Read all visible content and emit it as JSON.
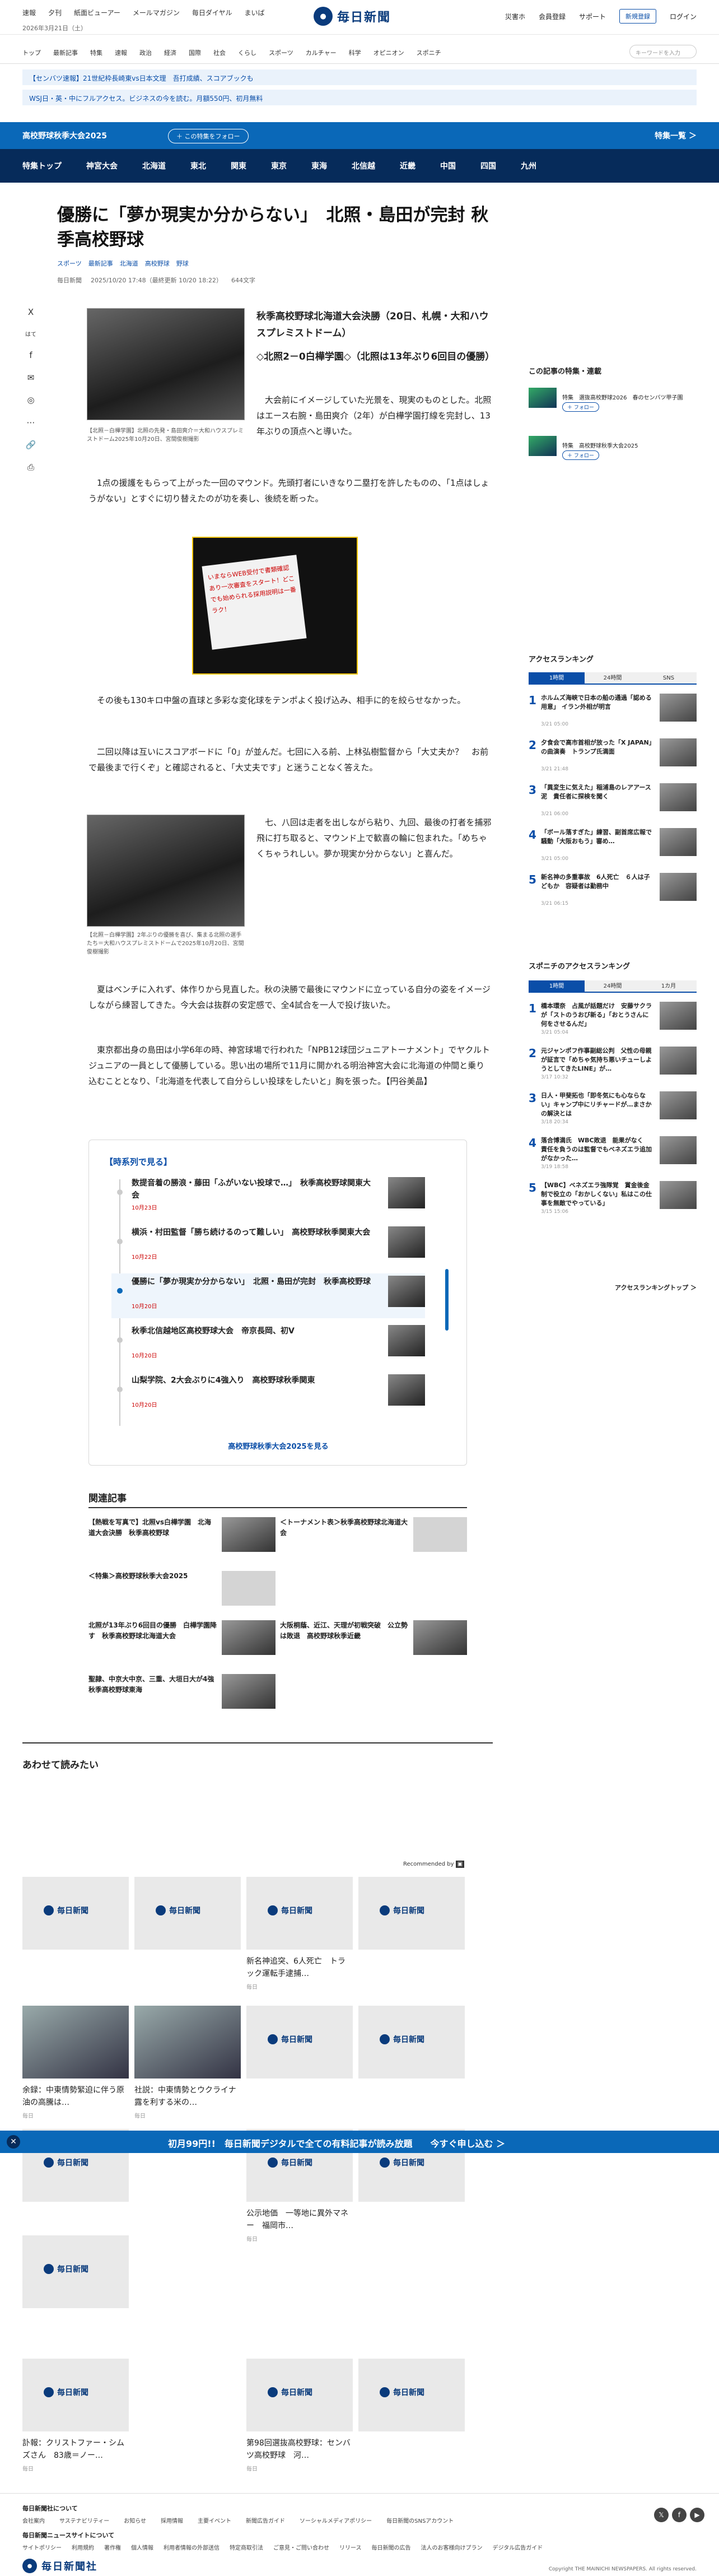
{
  "header": {
    "left_links": [
      "速報",
      "夕刊",
      "紙面ビューアー",
      "メールマガジン",
      "毎日ダイヤル",
      "まいば"
    ],
    "date": "2026年3月21日（土）",
    "logo_text": "毎日新聞",
    "right_links": [
      "災害ホ",
      "会員登録",
      "サポート"
    ],
    "register_label": "新規登録",
    "login_label": "ログイン"
  },
  "categories": [
    "トップ",
    "最新記事",
    "特集",
    "速報",
    "政治",
    "経済",
    "国際",
    "社会",
    "くらし",
    "スポーツ",
    "カルチャー",
    "科学",
    "オピニオン",
    "スポニチ"
  ],
  "search_placeholder": "キーワードを入力",
  "promos": [
    "【センバツ速報】21世紀枠長崎東vs日本文理　吾打成績、スコアブックも",
    "WSJ日・英・中にフルアクセス。ビジネスの今を読む。月額550円、初月無料"
  ],
  "series_bar": {
    "title": "高校野球秋季大会2025",
    "follow": "＋ この特集をフォロー",
    "special": "特集一覧 ＞"
  },
  "tabs": [
    "特集トップ",
    "神宮大会",
    "北海道",
    "東北",
    "関東",
    "東京",
    "東海",
    "北信越",
    "近畿",
    "中国",
    "四国",
    "九州"
  ],
  "article": {
    "title": "優勝に「夢か現実か分からない」　北照・島田が完封 秋季高校野球",
    "tags": [
      "スポーツ",
      "最新記事",
      "北海道",
      "高校野球",
      "野球"
    ],
    "meta": [
      "毎日新聞",
      "2025/10/20 17:48（最終更新 10/20 18:22）",
      "644文字"
    ],
    "share_icons": [
      "X",
      "はて",
      "f",
      "✉",
      "◎",
      "⋯",
      "🔗",
      "⎙"
    ],
    "caption1": "【北照－白樺学園】北照の先発・島田爽介＝大和ハウスプレミストドーム2025年10月20日、宮間俊樹撮影",
    "subhead1": "秋季高校野球北海道大会決勝（20日、札幌・大和ハウスプレミストドーム）",
    "subhead2": "◇北照2－0白樺学園◇（北照は13年ぶり6回目の優勝）",
    "para1": "大会前にイメージしていた光景を、現実のものとした。北照はエース右腕・島田爽介（2年）が白樺学園打線を完封し、13年ぶりの頂点へと導いた。",
    "para2": "1点の援護をもらって上がった一回のマウンド。先頭打者にいきなり二塁打を許したものの、「1点はしょうがない」とすぐに切り替えたのが功を奏し、後続を断った。",
    "ad_text": "いまならWEB受付で書類確認あり一次審査をスタート！どこでも始められる採用説明は一番ラク！",
    "para3": "その後も130キロ中盤の直球と多彩な変化球をテンポよく投げ込み、相手に的を絞らせなかった。",
    "para4": "二回以降は互いにスコアボードに「0」が並んだ。七回に入る前、上林弘樹監督から「大丈夫か？　お前で最後まで行くぞ」と確認されると、「大丈夫です」と迷うことなく答えた。",
    "caption2": "【北照－白樺学園】2年ぶりの優勝を喜び、集まる北照の選手たち＝大和ハウスプレミストドームで2025年10月20日、宮間俊樹撮影",
    "para5": "七、八回は走者を出しながら粘り、九回、最後の打者を捕邪飛に打ち取ると、マウンド上で歓喜の輪に包まれた。「めちゃくちゃうれしい。夢か現実か分からない」と喜んだ。",
    "para6": "夏はベンチに入れず、体作りから見直した。秋の決勝で最後にマウンドに立っている自分の姿をイメージしながら練習してきた。今大会は抜群の安定感で、全4試合を一人で投げ抜いた。",
    "para7": "東京都出身の島田は小学6年の時、神宮球場で行われた「NPB12球団ジュニアトーナメント」でヤクルトジュニアの一員として優勝している。思い出の場所で11月に開かれる明治神宮大会に北海道の仲間と乗り込むこととなり、「北海道を代表して自分らしい投球をしたいと」胸を張った。【円谷美晶】"
  },
  "series": {
    "head": "【時系列で見る】",
    "items": [
      {
        "title": "数提音着の勝浪・藤田「ふがいない投球で…」　秋季高校野球関東大会",
        "date": "10月23日"
      },
      {
        "title": "横浜・村田監督「勝ち続けるのって難しい」　高校野球秋季関東大会",
        "date": "10月22日"
      },
      {
        "title": "優勝に「夢か現実か分からない」　北照・島田が完封　秋季高校野球",
        "date": "10月20日"
      },
      {
        "title": "秋季北信越地区高校野球大会　帝京長岡、初V",
        "date": "10月20日"
      },
      {
        "title": "山梨学院、2大会ぶりに4強入り　高校野球秋季関東",
        "date": "10月20日"
      }
    ],
    "more": "高校野球秋季大会2025を見る"
  },
  "related": {
    "head": "関連記事",
    "items": [
      "【熱戦を写真で】北照vs白樺学園　北海道大会決勝　秋季高校野球",
      "＜トーナメント表＞秋季高校野球北海道大会",
      "＜特集＞高校野球秋季大会2025",
      "北照が13年ぶり6回目の優勝　白樺学園降す　秋季高校野球北海道大会",
      "大阪桐蔭、近江、天理が初戦突破　公立勢は敗退　高校野球秋季近畿",
      "聖隷、中京大中京、三重、大垣日大が4強　秋季高校野球東海"
    ]
  },
  "also_read": {
    "head": "あわせて読みたい",
    "rec": "Recommended by",
    "cards": [
      {
        "title": "",
        "source": ""
      },
      {
        "title": "",
        "source": ""
      },
      {
        "title": "新名神追突、6人死亡　トラック運転手逮捕…",
        "source": "毎日"
      },
      {
        "title": "",
        "source": ""
      },
      {
        "title": "余録：中東情勢緊迫に伴う原油の高騰は…",
        "source": "毎日"
      },
      {
        "title": "社説：中東情勢とウクライナ　露を利する米の…",
        "source": "毎日"
      },
      {
        "title": "",
        "source": ""
      },
      {
        "title": "",
        "source": ""
      },
      {
        "title": "",
        "source": ""
      },
      {
        "title": "公示地価　一等地に異外マネー　福岡市…",
        "source": "毎日"
      },
      {
        "title": "",
        "source": ""
      },
      {
        "title": "",
        "source": ""
      },
      {
        "title": "訃報：クリストファー・シムズさん　83歳＝ノー…",
        "source": "毎日"
      },
      {
        "title": "第98回選抜高校野球：センバツ高校野球　河…",
        "source": "毎日"
      },
      {
        "title": "",
        "source": ""
      }
    ]
  },
  "banner": {
    "text": "初月99円!!　毎日新聞デジタルで全ての有料記事が読み放題　　今すぐ申し込む ＞"
  },
  "sidebar": {
    "follow_head": "この記事の特集・連載",
    "follows": [
      {
        "label": "特集　選抜高校野球2026　春のセンバツ甲子園",
        "follow": "＋ フォロー"
      },
      {
        "label": "特集　高校野球秋季大会2025",
        "follow": "＋ フォロー"
      }
    ],
    "ranking_head": "アクセスランキング",
    "ranking_tabs": [
      "1時間",
      "24時間",
      "SNS"
    ],
    "ranking": [
      {
        "title": "ホルムズ海峡で日本の船の通過「認める用意」 イラン外相が明言",
        "date": "3/21 05:00"
      },
      {
        "title": "夕食会で高市首相が放った「X JAPAN」の曲演奏　トランプ氏満面",
        "date": "3/21 21:48"
      },
      {
        "title": "「異変生に気えた」稲浦島のレアアース泥　貴任者に探検を聞く",
        "date": "3/21 06:00"
      },
      {
        "title": "「ボール落すぎた」練習、副首席広報で騒動「大阪おもう」審め…",
        "date": "3/21 05:00"
      },
      {
        "title": "新名神の多重事故　6人死亡　６人は子どもか　容疑者は勤務中",
        "date": "3/21 06:15"
      }
    ],
    "sponichi_head": "スポニチのアクセスランキング",
    "sponichi_tabs": [
      "1時間",
      "24時間",
      "1カ月"
    ],
    "sponichi": [
      {
        "title": "橋本環奈　占風が話題だけ　安藤サクラが「ストのうおび新る」「おとうさんに何をさせるんだ」",
        "date": "3/21 05:04"
      },
      {
        "title": "元ジャンポフ作事副総公判　父性の母親が証言で「めちゃ気持ち悪いチューしようとしてきたLINE」が…",
        "date": "3/17 10:32"
      },
      {
        "title": "日人・甲斐拓也「即冬気にも心ならない」キャンプ中にリチャードが…まさかの解決とは",
        "date": "3/18 20:34"
      },
      {
        "title": "落合博満氏　WBC敗退　能果がなく　責任を負うのは監督でもベネズエラ追加がなかった…",
        "date": "3/19 18:58"
      },
      {
        "title": "【WBC】ベネズエラ強隊覚　賞金後金制で役立の「おかしくない」私はこの仕事を無敵でやっている」",
        "date": "3/15 15:06"
      }
    ],
    "ranking_more": "アクセスランキングトップ ＞"
  },
  "footer": {
    "head1": "毎日新聞社について",
    "links1": [
      "会社案内",
      "サステナビリティー",
      "お知らせ",
      "採用情報",
      "主要イベント",
      "新聞広告ガイド",
      "ソーシャルメディアポリシー",
      "毎日新聞のSNSアカウント"
    ],
    "head2": "毎日新聞ニュースサイトについて",
    "links2": [
      "サイトポリシー",
      "利用規約",
      "著作権",
      "個人情報",
      "利用者情報の外部送信",
      "特定商取引法",
      "ご意見・ご問い合わせ",
      "リリース",
      "毎日新聞の広告",
      "法人のお客様向けプラン",
      "デジタル広告ガイド"
    ],
    "social": [
      "𝕏",
      "f",
      "▶"
    ],
    "logo_text": "毎日新聞社",
    "copyright": "Copyright THE MAINICHI NEWSPAPERS. All rights reserved."
  }
}
